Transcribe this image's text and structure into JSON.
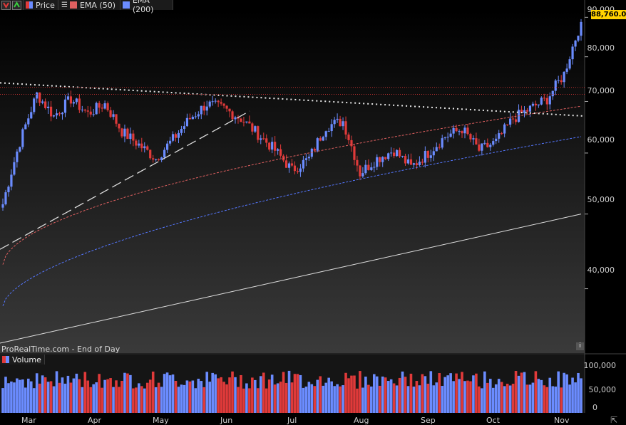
{
  "toolbar": {
    "price_label": "Price",
    "ema50_label": "EMA (50)",
    "ema200_label": "EMA (200)"
  },
  "watermark": "ProRealTime.com - End of Day",
  "volume_panel": {
    "label": "Volume"
  },
  "colors": {
    "up": "#6b8cff",
    "down": "#e03a3a",
    "ema50": "#e06060",
    "ema200": "#5577ff",
    "last_price_bg": "#ffd200"
  },
  "icons": [
    "arrow-down-icon",
    "arrow-up-icon",
    "price-swatch-icon",
    "list-icon",
    "info-icon",
    "expand-icon"
  ],
  "chart_data": {
    "type": "candlestick",
    "price_axis": {
      "scale": "log",
      "ticks": [
        40000,
        50000,
        60000,
        70000,
        80000,
        90000
      ],
      "tick_labels": [
        "40,000",
        "50,000",
        "60,000",
        "70,000",
        "80,000",
        "90,000"
      ],
      "ylim": [
        33000,
        92000
      ]
    },
    "last_price": 88760.01,
    "last_price_label": "88,760.01",
    "x_labels": [
      "Mar",
      "Apr",
      "May",
      "Jun",
      "Jul",
      "Aug",
      "Sep",
      "Oct",
      "Nov"
    ],
    "close_anchors": [
      [
        "Mar",
        51500
      ],
      [
        "Mar",
        62000
      ],
      [
        "Mar",
        71500
      ],
      [
        "Mar",
        67000
      ],
      [
        "Apr",
        70500
      ],
      [
        "Apr",
        67500
      ],
      [
        "Apr",
        69500
      ],
      [
        "Apr",
        64000
      ],
      [
        "May",
        61500
      ],
      [
        "May",
        59000
      ],
      [
        "May",
        62500
      ],
      [
        "May",
        66500
      ],
      [
        "Jun",
        69500
      ],
      [
        "Jun",
        68500
      ],
      [
        "Jun",
        66500
      ],
      [
        "Jun",
        63500
      ],
      [
        "Jul",
        60500
      ],
      [
        "Jul",
        57000
      ],
      [
        "Jul",
        59000
      ],
      [
        "Jul",
        65000
      ],
      [
        "Aug",
        66000
      ],
      [
        "Aug",
        56500
      ],
      [
        "Aug",
        59000
      ],
      [
        "Aug",
        60500
      ],
      [
        "Sep",
        57500
      ],
      [
        "Sep",
        60000
      ],
      [
        "Sep",
        63000
      ],
      [
        "Sep",
        64500
      ],
      [
        "Oct",
        60500
      ],
      [
        "Oct",
        62000
      ],
      [
        "Oct",
        66500
      ],
      [
        "Oct",
        68500
      ],
      [
        "Nov",
        70500
      ],
      [
        "Nov",
        76000
      ],
      [
        "Nov",
        88760
      ]
    ],
    "ema50": {
      "name": "EMA (50)",
      "start": 43000,
      "end": 69000
    },
    "ema200": {
      "name": "EMA (200)",
      "start": 38000,
      "end": 63000
    },
    "trendlines": {
      "resistance": {
        "start": 74000,
        "end": 67000,
        "style": "dotted"
      },
      "support_dashed": {
        "start": 45000,
        "end": 68000,
        "style": "dashed"
      },
      "long_support": {
        "start": 34000,
        "end": 50000,
        "style": "solid"
      }
    },
    "horizontal_levels": [
      73000,
      71500
    ],
    "volume": {
      "ticks": [
        0,
        50000,
        100000
      ],
      "tick_labels": [
        "0",
        "50,000",
        "100,000"
      ],
      "ylim": [
        0,
        120000
      ]
    }
  }
}
